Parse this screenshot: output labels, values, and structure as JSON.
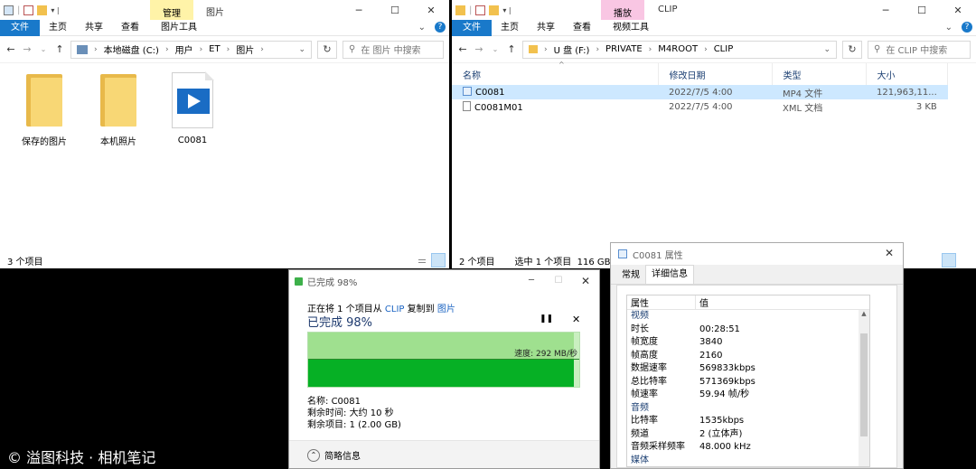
{
  "left_explorer": {
    "context_tab": "管理",
    "title": "图片",
    "ribbon_tabs": [
      "文件",
      "主页",
      "共享",
      "查看",
      "图片工具"
    ],
    "address": [
      "本地磁盘 (C:)",
      "用户",
      "ET",
      "图片"
    ],
    "search_placeholder": "在 图片 中搜索",
    "items": [
      "保存的图片",
      "本机照片",
      "C0081"
    ],
    "status": "3 个项目"
  },
  "right_explorer": {
    "context_tab": "播放",
    "title": "CLIP",
    "ribbon_tabs": [
      "文件",
      "主页",
      "共享",
      "查看",
      "视频工具"
    ],
    "address": [
      "U 盘 (F:)",
      "PRIVATE",
      "M4ROOT",
      "CLIP"
    ],
    "search_placeholder": "在 CLIP 中搜索",
    "columns": [
      "名称",
      "修改日期",
      "类型",
      "大小"
    ],
    "files": [
      {
        "name": "C0081",
        "date": "2022/7/5 4:00",
        "type": "MP4 文件",
        "size": "121,963,11..."
      },
      {
        "name": "C0081M01",
        "date": "2022/7/5 4:00",
        "type": "XML 文档",
        "size": "3 KB"
      }
    ],
    "status_count": "2 个项目",
    "status_selected": "选中 1 个项目",
    "status_size": "116 GB"
  },
  "copy_dialog": {
    "title": "已完成 98%",
    "line_prefix": "正在将 1 个项目从",
    "source": "CLIP",
    "line_mid": "复制到",
    "dest": "图片",
    "heading": "已完成 98%",
    "progress": 0.98,
    "speed": "速度: 292 MB/秒",
    "name_label": "名称:",
    "name_value": "C0081",
    "remaining_time_label": "剩余时间:",
    "remaining_time_value": "大约 10 秒",
    "remaining_items_label": "剩余项目:",
    "remaining_items_value": "1 (2.00 GB)",
    "less_info": "简略信息",
    "pause_icon": "pause-icon",
    "close_icon": "close-icon"
  },
  "properties": {
    "title": "C0081 属性",
    "tabs": [
      "常规",
      "详细信息"
    ],
    "col_property": "属性",
    "col_value": "值",
    "sections": [
      {
        "heading": "视频",
        "rows": [
          {
            "k": "时长",
            "v": "00:28:51"
          },
          {
            "k": "帧宽度",
            "v": "3840"
          },
          {
            "k": "帧高度",
            "v": "2160"
          },
          {
            "k": "数据速率",
            "v": "569833kbps"
          },
          {
            "k": "总比特率",
            "v": "571369kbps"
          },
          {
            "k": "帧速率",
            "v": "59.94 帧/秒"
          }
        ]
      },
      {
        "heading": "音频",
        "rows": [
          {
            "k": "比特率",
            "v": "1535kbps"
          },
          {
            "k": "频道",
            "v": "2 (立体声)"
          },
          {
            "k": "音频采样频率",
            "v": "48.000 kHz"
          }
        ]
      },
      {
        "heading": "媒体",
        "rows": []
      }
    ]
  },
  "watermark": "© 溢图科技 · 相机笔记",
  "colors": {
    "accent": "#1979ca",
    "context_tab_left": "#fff3a8",
    "context_tab_right": "#f9c6e3",
    "progress_light": "#9fe08f",
    "progress_dark": "#06b025",
    "selection": "#cde8ff"
  }
}
